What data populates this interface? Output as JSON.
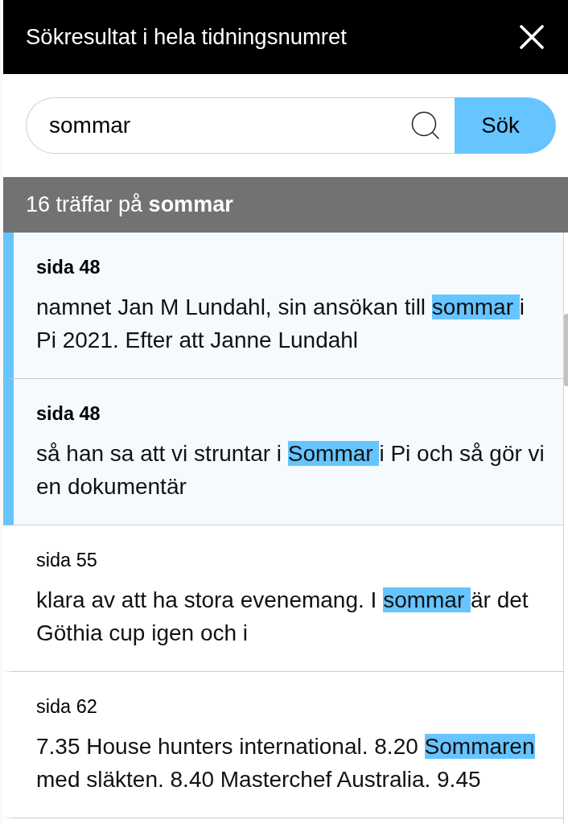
{
  "header": {
    "title": "Sökresultat i hela tidningsnumret"
  },
  "search": {
    "value": "sommar",
    "button": "Sök"
  },
  "summary": "16 träffar på **sommar**",
  "results": [
    {
      "page": "sida 48",
      "selected": true,
      "snippet": [
        {
          "text": "namnet Jan M Lundahl, sin ansökan till ",
          "highlighted": false
        },
        {
          "text": "sommar ",
          "highlighted": true
        },
        {
          "text": "i Pi 2021. Efter att Janne Lundahl",
          "highlighted": false
        }
      ]
    },
    {
      "page": "sida 48",
      "selected": true,
      "snippet": [
        {
          "text": "så han sa att vi struntar i ",
          "highlighted": false
        },
        {
          "text": "Sommar ",
          "highlighted": true
        },
        {
          "text": "i Pi och så gör vi en dokumentär",
          "highlighted": false
        }
      ]
    },
    {
      "page": "sida 55",
      "selected": false,
      "snippet": [
        {
          "text": "klara av att ha stora evenemang. I ",
          "highlighted": false
        },
        {
          "text": "sommar ",
          "highlighted": true
        },
        {
          "text": "är det Göthia cup igen och i",
          "highlighted": false
        }
      ]
    },
    {
      "page": "sida 62",
      "selected": false,
      "snippet": [
        {
          "text": "7.35 House hunters international. 8.20 ",
          "highlighted": false
        },
        {
          "text": "Sommaren",
          "highlighted": true
        },
        {
          "text": " med släkten. 8.40 Masterchef Australia. 9.45",
          "highlighted": false
        }
      ]
    }
  ]
}
